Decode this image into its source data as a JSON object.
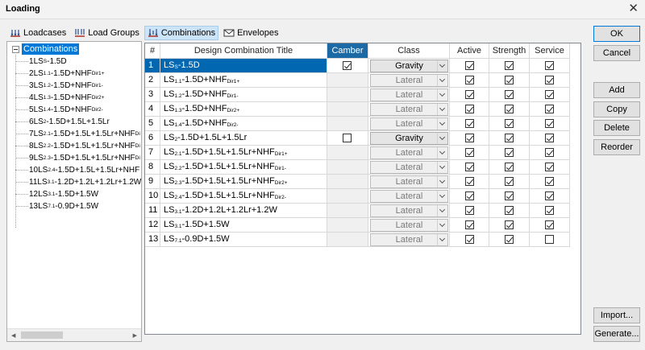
{
  "window": {
    "title": "Loading",
    "close_glyph": "✕"
  },
  "tabs": [
    {
      "label": "Loadcases",
      "icon": "loadcases-icon",
      "selected": false
    },
    {
      "label": "Load Groups",
      "icon": "load-groups-icon",
      "selected": false
    },
    {
      "label": "Combinations",
      "icon": "combinations-icon",
      "selected": true
    },
    {
      "label": "Envelopes",
      "icon": "envelopes-icon",
      "selected": false
    }
  ],
  "tree": {
    "root": "Combinations",
    "items": [
      {
        "num": "1",
        "pre": "LS",
        "sub": "S",
        "post": "-1.5D"
      },
      {
        "num": "2",
        "pre": "LS",
        "sub": "1.1",
        "post": "-1.5D+NHF",
        "sub2": "Dir1+"
      },
      {
        "num": "3",
        "pre": "LS",
        "sub": "1.2",
        "post": "-1.5D+NHF",
        "sub2": "Dir1-"
      },
      {
        "num": "4",
        "pre": "LS",
        "sub": "1.3",
        "post": "-1.5D+NHF",
        "sub2": "Dir2+"
      },
      {
        "num": "5",
        "pre": "LS",
        "sub": "1.4",
        "post": "-1.5D+NHF",
        "sub2": "Dir2-"
      },
      {
        "num": "6",
        "pre": "LS",
        "sub": "2",
        "post": "-1.5D+1.5L+1.5Lr"
      },
      {
        "num": "7",
        "pre": "LS",
        "sub": "2.1",
        "post": "-1.5D+1.5L+1.5Lr+NHF",
        "sub2": "Di"
      },
      {
        "num": "8",
        "pre": "LS",
        "sub": "2.2",
        "post": "-1.5D+1.5L+1.5Lr+NHF",
        "sub2": "Di"
      },
      {
        "num": "9",
        "pre": "LS",
        "sub": "2.3",
        "post": "-1.5D+1.5L+1.5Lr+NHF",
        "sub2": "Di"
      },
      {
        "num": "10",
        "pre": "LS",
        "sub": "2.4",
        "post": "-1.5D+1.5L+1.5Lr+NHF"
      },
      {
        "num": "11",
        "pre": "LS",
        "sub": "3.1",
        "post": "-1.2D+1.2L+1.2Lr+1.2W"
      },
      {
        "num": "12",
        "pre": "LS",
        "sub": "3.1",
        "post": "-1.5D+1.5W"
      },
      {
        "num": "13",
        "pre": "LS",
        "sub": "7.1",
        "post": "-0.9D+1.5W"
      }
    ]
  },
  "grid": {
    "columns": {
      "num": "#",
      "title": "Design Combination Title",
      "camber": "Camber",
      "class": "Class",
      "active": "Active",
      "strength": "Strength",
      "service": "Service"
    },
    "rows": [
      {
        "num": "1",
        "pre": "LS",
        "sub": "S",
        "post": "-1.5D",
        "camber": true,
        "class": "Gravity",
        "active": true,
        "strength": true,
        "service": true
      },
      {
        "num": "2",
        "pre": "LS",
        "sub": "1.1",
        "post": "-1.5D+NHF",
        "sub2": "Dir1+",
        "camber": null,
        "class": "Lateral",
        "active": true,
        "strength": true,
        "service": true
      },
      {
        "num": "3",
        "pre": "LS",
        "sub": "1.2",
        "post": "-1.5D+NHF",
        "sub2": "Dir1-",
        "camber": null,
        "class": "Lateral",
        "active": true,
        "strength": true,
        "service": true
      },
      {
        "num": "4",
        "pre": "LS",
        "sub": "1.3",
        "post": "-1.5D+NHF",
        "sub2": "Dir2+",
        "camber": null,
        "class": "Lateral",
        "active": true,
        "strength": true,
        "service": true
      },
      {
        "num": "5",
        "pre": "LS",
        "sub": "1.4",
        "post": "-1.5D+NHF",
        "sub2": "Dir2-",
        "camber": null,
        "class": "Lateral",
        "active": true,
        "strength": true,
        "service": true
      },
      {
        "num": "6",
        "pre": "LS",
        "sub": "2",
        "post": "-1.5D+1.5L+1.5Lr",
        "camber": false,
        "class": "Gravity",
        "active": true,
        "strength": true,
        "service": true
      },
      {
        "num": "7",
        "pre": "LS",
        "sub": "2.1",
        "post": "-1.5D+1.5L+1.5Lr+NHF",
        "sub2": "Dir1+",
        "camber": null,
        "class": "Lateral",
        "active": true,
        "strength": true,
        "service": true
      },
      {
        "num": "8",
        "pre": "LS",
        "sub": "2.2",
        "post": "-1.5D+1.5L+1.5Lr+NHF",
        "sub2": "Dir1-",
        "camber": null,
        "class": "Lateral",
        "active": true,
        "strength": true,
        "service": true
      },
      {
        "num": "9",
        "pre": "LS",
        "sub": "2.3",
        "post": "-1.5D+1.5L+1.5Lr+NHF",
        "sub2": "Dir2+",
        "camber": null,
        "class": "Lateral",
        "active": true,
        "strength": true,
        "service": true
      },
      {
        "num": "10",
        "pre": "LS",
        "sub": "2.4",
        "post": "-1.5D+1.5L+1.5Lr+NHF",
        "sub2": "Dir2-",
        "camber": null,
        "class": "Lateral",
        "active": true,
        "strength": true,
        "service": true
      },
      {
        "num": "11",
        "pre": "LS",
        "sub": "3.1",
        "post": "-1.2D+1.2L+1.2Lr+1.2W",
        "camber": null,
        "class": "Lateral",
        "active": true,
        "strength": true,
        "service": true
      },
      {
        "num": "12",
        "pre": "LS",
        "sub": "3.1",
        "post": "-1.5D+1.5W",
        "camber": null,
        "class": "Lateral",
        "active": true,
        "strength": true,
        "service": true
      },
      {
        "num": "13",
        "pre": "LS",
        "sub": "7.1",
        "post": "-0.9D+1.5W",
        "camber": null,
        "class": "Lateral",
        "active": true,
        "strength": true,
        "service": false
      }
    ]
  },
  "buttons": {
    "ok": "OK",
    "cancel": "Cancel",
    "add": "Add",
    "copy": "Copy",
    "delete": "Delete",
    "reorder": "Reorder",
    "import": "Import...",
    "generate": "Generate..."
  },
  "colors": {
    "selection": "#0067b0",
    "camber_header": "#1b6aa5",
    "tab_selected": "#cce4f7"
  }
}
